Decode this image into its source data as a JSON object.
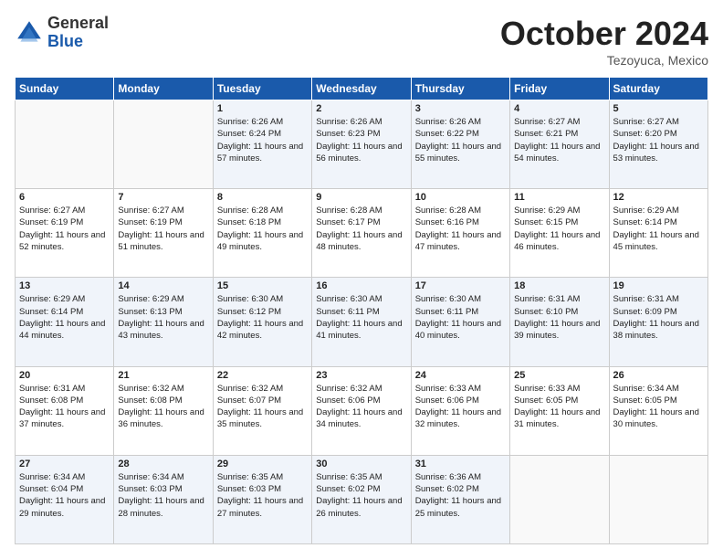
{
  "header": {
    "logo_general": "General",
    "logo_blue": "Blue",
    "month_title": "October 2024",
    "location": "Tezoyuca, Mexico"
  },
  "days_of_week": [
    "Sunday",
    "Monday",
    "Tuesday",
    "Wednesday",
    "Thursday",
    "Friday",
    "Saturday"
  ],
  "weeks": [
    [
      {
        "day": "",
        "info": ""
      },
      {
        "day": "",
        "info": ""
      },
      {
        "day": "1",
        "info": "Sunrise: 6:26 AM\nSunset: 6:24 PM\nDaylight: 11 hours and 57 minutes."
      },
      {
        "day": "2",
        "info": "Sunrise: 6:26 AM\nSunset: 6:23 PM\nDaylight: 11 hours and 56 minutes."
      },
      {
        "day": "3",
        "info": "Sunrise: 6:26 AM\nSunset: 6:22 PM\nDaylight: 11 hours and 55 minutes."
      },
      {
        "day": "4",
        "info": "Sunrise: 6:27 AM\nSunset: 6:21 PM\nDaylight: 11 hours and 54 minutes."
      },
      {
        "day": "5",
        "info": "Sunrise: 6:27 AM\nSunset: 6:20 PM\nDaylight: 11 hours and 53 minutes."
      }
    ],
    [
      {
        "day": "6",
        "info": "Sunrise: 6:27 AM\nSunset: 6:19 PM\nDaylight: 11 hours and 52 minutes."
      },
      {
        "day": "7",
        "info": "Sunrise: 6:27 AM\nSunset: 6:19 PM\nDaylight: 11 hours and 51 minutes."
      },
      {
        "day": "8",
        "info": "Sunrise: 6:28 AM\nSunset: 6:18 PM\nDaylight: 11 hours and 49 minutes."
      },
      {
        "day": "9",
        "info": "Sunrise: 6:28 AM\nSunset: 6:17 PM\nDaylight: 11 hours and 48 minutes."
      },
      {
        "day": "10",
        "info": "Sunrise: 6:28 AM\nSunset: 6:16 PM\nDaylight: 11 hours and 47 minutes."
      },
      {
        "day": "11",
        "info": "Sunrise: 6:29 AM\nSunset: 6:15 PM\nDaylight: 11 hours and 46 minutes."
      },
      {
        "day": "12",
        "info": "Sunrise: 6:29 AM\nSunset: 6:14 PM\nDaylight: 11 hours and 45 minutes."
      }
    ],
    [
      {
        "day": "13",
        "info": "Sunrise: 6:29 AM\nSunset: 6:14 PM\nDaylight: 11 hours and 44 minutes."
      },
      {
        "day": "14",
        "info": "Sunrise: 6:29 AM\nSunset: 6:13 PM\nDaylight: 11 hours and 43 minutes."
      },
      {
        "day": "15",
        "info": "Sunrise: 6:30 AM\nSunset: 6:12 PM\nDaylight: 11 hours and 42 minutes."
      },
      {
        "day": "16",
        "info": "Sunrise: 6:30 AM\nSunset: 6:11 PM\nDaylight: 11 hours and 41 minutes."
      },
      {
        "day": "17",
        "info": "Sunrise: 6:30 AM\nSunset: 6:11 PM\nDaylight: 11 hours and 40 minutes."
      },
      {
        "day": "18",
        "info": "Sunrise: 6:31 AM\nSunset: 6:10 PM\nDaylight: 11 hours and 39 minutes."
      },
      {
        "day": "19",
        "info": "Sunrise: 6:31 AM\nSunset: 6:09 PM\nDaylight: 11 hours and 38 minutes."
      }
    ],
    [
      {
        "day": "20",
        "info": "Sunrise: 6:31 AM\nSunset: 6:08 PM\nDaylight: 11 hours and 37 minutes."
      },
      {
        "day": "21",
        "info": "Sunrise: 6:32 AM\nSunset: 6:08 PM\nDaylight: 11 hours and 36 minutes."
      },
      {
        "day": "22",
        "info": "Sunrise: 6:32 AM\nSunset: 6:07 PM\nDaylight: 11 hours and 35 minutes."
      },
      {
        "day": "23",
        "info": "Sunrise: 6:32 AM\nSunset: 6:06 PM\nDaylight: 11 hours and 34 minutes."
      },
      {
        "day": "24",
        "info": "Sunrise: 6:33 AM\nSunset: 6:06 PM\nDaylight: 11 hours and 32 minutes."
      },
      {
        "day": "25",
        "info": "Sunrise: 6:33 AM\nSunset: 6:05 PM\nDaylight: 11 hours and 31 minutes."
      },
      {
        "day": "26",
        "info": "Sunrise: 6:34 AM\nSunset: 6:05 PM\nDaylight: 11 hours and 30 minutes."
      }
    ],
    [
      {
        "day": "27",
        "info": "Sunrise: 6:34 AM\nSunset: 6:04 PM\nDaylight: 11 hours and 29 minutes."
      },
      {
        "day": "28",
        "info": "Sunrise: 6:34 AM\nSunset: 6:03 PM\nDaylight: 11 hours and 28 minutes."
      },
      {
        "day": "29",
        "info": "Sunrise: 6:35 AM\nSunset: 6:03 PM\nDaylight: 11 hours and 27 minutes."
      },
      {
        "day": "30",
        "info": "Sunrise: 6:35 AM\nSunset: 6:02 PM\nDaylight: 11 hours and 26 minutes."
      },
      {
        "day": "31",
        "info": "Sunrise: 6:36 AM\nSunset: 6:02 PM\nDaylight: 11 hours and 25 minutes."
      },
      {
        "day": "",
        "info": ""
      },
      {
        "day": "",
        "info": ""
      }
    ]
  ]
}
